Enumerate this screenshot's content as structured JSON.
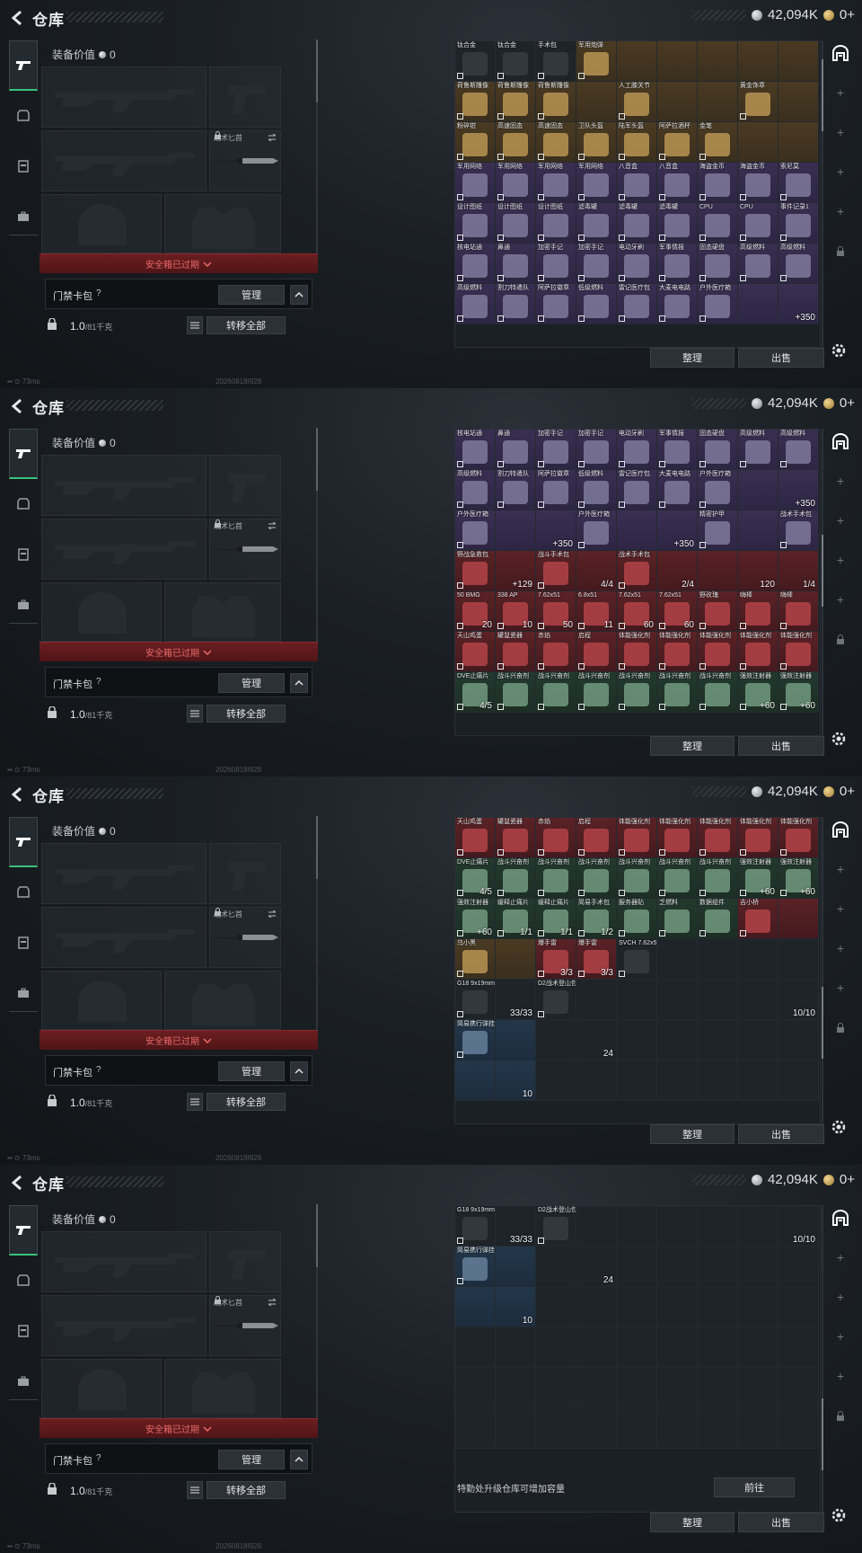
{
  "header": {
    "title": "仓库",
    "currency_value": "42,094K",
    "premium_value": "0+"
  },
  "equipment": {
    "value_label": "装备价值",
    "value_amount": "0",
    "knife_label": "战术匕首",
    "expired_text": "安全箱已过期",
    "keycard_label": "门禁卡包",
    "help": "?",
    "manage_label": "管理",
    "collapse_glyph": "^",
    "weight_value": "1.0",
    "weight_capacity": "/81千克",
    "transfer_all_label": "转移全部"
  },
  "left_tabs": [
    {
      "icon": "gun-icon"
    },
    {
      "icon": "armor-icon"
    },
    {
      "icon": "vest-icon"
    },
    {
      "icon": "backpack-icon"
    }
  ],
  "status_bar": {
    "ping": "73ms",
    "build": "20260818I928"
  },
  "stash": {
    "sort_label": "整理",
    "sell_label": "出售",
    "upgrade_text": "特勤处升级仓库可增加容量",
    "goto_label": "前往"
  },
  "right_rail": [
    "base-icon",
    "plus-icon",
    "plus-icon",
    "plus-icon",
    "plus-icon",
    "plus-icon",
    "lock-icon"
  ],
  "frames": [
    {
      "scroll_thumb_top": 0.08,
      "cells": [
        {
          "n": "钛合金",
          "r": "grey"
        },
        {
          "n": "钛合金",
          "r": "grey"
        },
        {
          "n": "手术包",
          "r": "grey"
        },
        {
          "n": "军用炮弹",
          "r": "gold"
        },
        {
          "n": "",
          "r": "gold"
        },
        {
          "n": "",
          "r": "gold"
        },
        {
          "n": "",
          "r": "gold"
        },
        {
          "n": "",
          "r": "gold"
        },
        {
          "n": "",
          "r": "gold"
        },
        {
          "n": "荷鲁斯雕像",
          "r": "gold"
        },
        {
          "n": "荷鲁斯雕像",
          "r": "gold"
        },
        {
          "n": "荷鲁斯雕像",
          "r": "gold"
        },
        {
          "n": "",
          "r": "gold"
        },
        {
          "n": "人工膝关节",
          "r": "gold"
        },
        {
          "n": "",
          "r": "gold"
        },
        {
          "n": "",
          "r": "gold"
        },
        {
          "n": "黄金饰章",
          "r": "gold"
        },
        {
          "n": "",
          "r": "gold"
        },
        {
          "n": "粉碎钳",
          "r": "gold"
        },
        {
          "n": "高速固态",
          "r": "gold"
        },
        {
          "n": "高速固态",
          "r": "gold"
        },
        {
          "n": "卫队头盔",
          "r": "gold"
        },
        {
          "n": "陆军头盔",
          "r": "gold"
        },
        {
          "n": "阿萨拉酒杯",
          "r": "gold"
        },
        {
          "n": "金笔",
          "r": "gold"
        },
        {
          "n": "",
          "r": "gold"
        },
        {
          "n": "",
          "r": "gold"
        },
        {
          "n": "军用网络",
          "r": "purple"
        },
        {
          "n": "军用网络",
          "r": "purple"
        },
        {
          "n": "军用网络",
          "r": "purple"
        },
        {
          "n": "军用网络",
          "r": "purple"
        },
        {
          "n": "八音盒",
          "r": "purple"
        },
        {
          "n": "八音盒",
          "r": "purple"
        },
        {
          "n": "海盗金币",
          "r": "purple"
        },
        {
          "n": "海盗金币",
          "r": "purple"
        },
        {
          "n": "索尼莫",
          "r": "purple"
        },
        {
          "n": "设计图纸",
          "r": "purple"
        },
        {
          "n": "设计图纸",
          "r": "purple"
        },
        {
          "n": "设计图纸",
          "r": "purple"
        },
        {
          "n": "滤毒罐",
          "r": "purple"
        },
        {
          "n": "滤毒罐",
          "r": "purple"
        },
        {
          "n": "滤毒罐",
          "r": "purple"
        },
        {
          "n": "CPU",
          "r": "purple"
        },
        {
          "n": "CPU",
          "r": "purple"
        },
        {
          "n": "事件记录1",
          "r": "purple"
        },
        {
          "n": "核电站通",
          "r": "purple"
        },
        {
          "n": "鼻通",
          "r": "purple"
        },
        {
          "n": "加密手记",
          "r": "purple"
        },
        {
          "n": "加密手记",
          "r": "purple"
        },
        {
          "n": "电动牙刷",
          "r": "purple"
        },
        {
          "n": "军事情报",
          "r": "purple"
        },
        {
          "n": "固态硬盘",
          "r": "purple"
        },
        {
          "n": "高级燃料",
          "r": "purple"
        },
        {
          "n": "高级燃料",
          "r": "purple"
        },
        {
          "n": "高级燃料",
          "r": "purple"
        },
        {
          "n": "割刀特遣队",
          "r": "purple"
        },
        {
          "n": "阿萨拉徽章",
          "r": "purple"
        },
        {
          "n": "低级燃料",
          "r": "purple"
        },
        {
          "n": "雷记医疗包",
          "r": "purple"
        },
        {
          "n": "大麦电电路",
          "r": "purple"
        },
        {
          "n": "户外医疗箱",
          "r": "purple"
        },
        {
          "n": "",
          "r": "purple"
        },
        {
          "n": "",
          "r": "purple",
          "c": "+350"
        }
      ]
    },
    {
      "scroll_thumb_top": 0.45,
      "cells": [
        {
          "n": "核电站通",
          "r": "purple"
        },
        {
          "n": "鼻通",
          "r": "purple"
        },
        {
          "n": "加密手记",
          "r": "purple"
        },
        {
          "n": "加密手记",
          "r": "purple"
        },
        {
          "n": "电动牙刷",
          "r": "purple"
        },
        {
          "n": "军事情报",
          "r": "purple"
        },
        {
          "n": "固态硬盘",
          "r": "purple"
        },
        {
          "n": "高级燃料",
          "r": "purple"
        },
        {
          "n": "高级燃料",
          "r": "purple"
        },
        {
          "n": "高级燃料",
          "r": "purple"
        },
        {
          "n": "割刀特遣队",
          "r": "purple"
        },
        {
          "n": "阿萨拉徽章",
          "r": "purple"
        },
        {
          "n": "低级燃料",
          "r": "purple"
        },
        {
          "n": "雷记医疗包",
          "r": "purple"
        },
        {
          "n": "大麦电电路",
          "r": "purple"
        },
        {
          "n": "户外医疗箱",
          "r": "purple"
        },
        {
          "n": "",
          "r": "purple"
        },
        {
          "n": "",
          "r": "purple",
          "c": "+350"
        },
        {
          "n": "户外医疗箱",
          "r": "purple"
        },
        {
          "n": "",
          "r": "purple"
        },
        {
          "n": "",
          "r": "purple",
          "c": "+350"
        },
        {
          "n": "户外医疗箱",
          "r": "purple"
        },
        {
          "n": "",
          "r": "purple"
        },
        {
          "n": "",
          "r": "purple",
          "c": "+350"
        },
        {
          "n": "精密护甲",
          "r": "purple"
        },
        {
          "n": "",
          "r": "purple"
        },
        {
          "n": "战术手术包",
          "r": "purple"
        },
        {
          "n": "野战急救包",
          "r": "red"
        },
        {
          "n": "",
          "r": "red",
          "c": "+129"
        },
        {
          "n": "战斗手术包",
          "r": "red"
        },
        {
          "n": "",
          "r": "red",
          "c": "4/4"
        },
        {
          "n": "战术手术包",
          "r": "red"
        },
        {
          "n": "",
          "r": "red",
          "c": "2/4"
        },
        {
          "n": "",
          "r": "red"
        },
        {
          "n": "",
          "r": "red",
          "c": "120"
        },
        {
          "n": "",
          "r": "red",
          "c": "1/4"
        },
        {
          "n": "50 BMG",
          "r": "red",
          "c": "20"
        },
        {
          "n": "338 AP",
          "r": "red",
          "c": "10"
        },
        {
          "n": "7.62x51",
          "r": "red",
          "c": "50"
        },
        {
          "n": "6.8x51",
          "r": "red",
          "c": "11"
        },
        {
          "n": "7.62x51",
          "r": "red",
          "c": "60"
        },
        {
          "n": "7.62x51",
          "r": "red",
          "c": "60"
        },
        {
          "n": "野玫瑰",
          "r": "red"
        },
        {
          "n": "嗨棒",
          "r": "red"
        },
        {
          "n": "嗨棒",
          "r": "red"
        },
        {
          "n": "天山鸡蛋",
          "r": "red"
        },
        {
          "n": "罐鼠瓷器",
          "r": "red"
        },
        {
          "n": "赤焰",
          "r": "red"
        },
        {
          "n": "启程",
          "r": "red"
        },
        {
          "n": "体能强化剂",
          "r": "red"
        },
        {
          "n": "体能强化剂",
          "r": "red"
        },
        {
          "n": "体能强化剂",
          "r": "red"
        },
        {
          "n": "体能强化剂",
          "r": "red"
        },
        {
          "n": "体能强化剂",
          "r": "red"
        },
        {
          "n": "DVE止痛片",
          "r": "green",
          "c": "4/5"
        },
        {
          "n": "战斗兴奋剂",
          "r": "green"
        },
        {
          "n": "战斗兴奋剂",
          "r": "green"
        },
        {
          "n": "战斗兴奋剂",
          "r": "green"
        },
        {
          "n": "战斗兴奋剂",
          "r": "green"
        },
        {
          "n": "战斗兴奋剂",
          "r": "green"
        },
        {
          "n": "战斗兴奋剂",
          "r": "green"
        },
        {
          "n": "强效注射器",
          "r": "green",
          "c": "+60"
        },
        {
          "n": "强效注射器",
          "r": "green",
          "c": "+60"
        }
      ]
    },
    {
      "scroll_thumb_top": 0.72,
      "cells": [
        {
          "n": "天山鸡蛋",
          "r": "red"
        },
        {
          "n": "罐鼠瓷器",
          "r": "red"
        },
        {
          "n": "赤焰",
          "r": "red"
        },
        {
          "n": "启程",
          "r": "red"
        },
        {
          "n": "体能强化剂",
          "r": "red"
        },
        {
          "n": "体能强化剂",
          "r": "red"
        },
        {
          "n": "体能强化剂",
          "r": "red"
        },
        {
          "n": "体能强化剂",
          "r": "red"
        },
        {
          "n": "体能强化剂",
          "r": "red"
        },
        {
          "n": "DVE止痛片",
          "r": "green",
          "c": "4/5"
        },
        {
          "n": "战斗兴奋剂",
          "r": "green"
        },
        {
          "n": "战斗兴奋剂",
          "r": "green"
        },
        {
          "n": "战斗兴奋剂",
          "r": "green"
        },
        {
          "n": "战斗兴奋剂",
          "r": "green"
        },
        {
          "n": "战斗兴奋剂",
          "r": "green"
        },
        {
          "n": "战斗兴奋剂",
          "r": "green"
        },
        {
          "n": "强效注射器",
          "r": "green",
          "c": "+60"
        },
        {
          "n": "强效注射器",
          "r": "green",
          "c": "+60"
        },
        {
          "n": "强效注射器",
          "r": "green",
          "c": "+60"
        },
        {
          "n": "缓释止痛片",
          "r": "green",
          "c": "1/1"
        },
        {
          "n": "缓释止痛片",
          "r": "green",
          "c": "1/1"
        },
        {
          "n": "简易手术包",
          "r": "green",
          "c": "1/2"
        },
        {
          "n": "服务器贴",
          "r": "green"
        },
        {
          "n": "乏燃料",
          "r": "green"
        },
        {
          "n": "数据组件",
          "r": "green"
        },
        {
          "n": "吉小桥",
          "r": "red"
        },
        {
          "n": "",
          "r": "red"
        },
        {
          "n": "乌小黑",
          "r": "gold"
        },
        {
          "n": "",
          "r": "gold"
        },
        {
          "n": "爆手雷",
          "r": "red",
          "c": "3/3"
        },
        {
          "n": "爆手雷",
          "r": "red",
          "c": "3/3"
        },
        {
          "n": "SVCH 7.62x54R",
          "r": "grey"
        },
        {
          "n": "",
          "r": "grey"
        },
        {
          "n": "",
          "r": "grey"
        },
        {
          "n": "",
          "r": "grey"
        },
        {
          "n": "",
          "r": "grey"
        },
        {
          "n": "G18 9x19mm",
          "r": "grey"
        },
        {
          "n": "",
          "r": "grey",
          "c": "33/33"
        },
        {
          "n": "D2战术登山包",
          "r": "grey"
        },
        {
          "n": "",
          "r": "grey"
        },
        {
          "n": "",
          "r": "grey"
        },
        {
          "n": "",
          "r": "grey"
        },
        {
          "n": "",
          "r": "grey"
        },
        {
          "n": "",
          "r": "grey"
        },
        {
          "n": "",
          "r": "grey",
          "c": "10/10"
        },
        {
          "n": "简易携行弹挂",
          "r": "blue"
        },
        {
          "n": "",
          "r": "blue"
        },
        {
          "n": "",
          "r": "grey"
        },
        {
          "n": "",
          "r": "grey",
          "c": "24"
        },
        {
          "n": "",
          "r": "grey"
        },
        {
          "n": "",
          "r": "grey"
        },
        {
          "n": "",
          "r": "grey"
        },
        {
          "n": "",
          "r": "grey"
        },
        {
          "n": "",
          "r": "grey"
        },
        {
          "n": "",
          "r": "blue"
        },
        {
          "n": "",
          "r": "blue",
          "c": "10"
        },
        {
          "n": "",
          "r": "grey"
        },
        {
          "n": "",
          "r": "grey"
        },
        {
          "n": "",
          "r": "grey"
        },
        {
          "n": "",
          "r": "grey"
        },
        {
          "n": "",
          "r": "grey"
        },
        {
          "n": "",
          "r": "grey"
        },
        {
          "n": "",
          "r": "grey"
        }
      ]
    },
    {
      "scroll_thumb_top": 0.82,
      "show_upgrade": true,
      "cells": [
        {
          "n": "G18 9x19mm",
          "r": "grey"
        },
        {
          "n": "",
          "r": "grey",
          "c": "33/33"
        },
        {
          "n": "D2战术登山包",
          "r": "grey"
        },
        {
          "n": "",
          "r": "grey"
        },
        {
          "n": "",
          "r": "grey"
        },
        {
          "n": "",
          "r": "grey"
        },
        {
          "n": "",
          "r": "grey"
        },
        {
          "n": "",
          "r": "grey"
        },
        {
          "n": "",
          "r": "grey",
          "c": "10/10"
        },
        {
          "n": "简易携行弹挂",
          "r": "blue"
        },
        {
          "n": "",
          "r": "blue"
        },
        {
          "n": "",
          "r": "grey"
        },
        {
          "n": "",
          "r": "grey",
          "c": "24"
        },
        {
          "n": "",
          "r": "grey"
        },
        {
          "n": "",
          "r": "grey"
        },
        {
          "n": "",
          "r": "grey"
        },
        {
          "n": "",
          "r": "grey"
        },
        {
          "n": "",
          "r": "grey"
        },
        {
          "n": "",
          "r": "blue"
        },
        {
          "n": "",
          "r": "blue",
          "c": "10"
        },
        {
          "n": "",
          "r": "grey"
        },
        {
          "n": "",
          "r": "grey"
        },
        {
          "n": "",
          "r": "grey"
        },
        {
          "n": "",
          "r": "grey"
        },
        {
          "n": "",
          "r": "grey"
        },
        {
          "n": "",
          "r": "grey"
        },
        {
          "n": "",
          "r": "grey"
        },
        {
          "n": "",
          "r": "grey"
        },
        {
          "n": "",
          "r": "grey"
        },
        {
          "n": "",
          "r": "grey"
        },
        {
          "n": "",
          "r": "grey"
        },
        {
          "n": "",
          "r": "grey"
        },
        {
          "n": "",
          "r": "grey"
        },
        {
          "n": "",
          "r": "grey"
        },
        {
          "n": "",
          "r": "grey"
        },
        {
          "n": "",
          "r": "grey"
        },
        {
          "n": "",
          "r": "grey"
        },
        {
          "n": "",
          "r": "grey"
        },
        {
          "n": "",
          "r": "grey"
        },
        {
          "n": "",
          "r": "grey"
        },
        {
          "n": "",
          "r": "grey"
        },
        {
          "n": "",
          "r": "grey"
        },
        {
          "n": "",
          "r": "grey"
        },
        {
          "n": "",
          "r": "grey"
        },
        {
          "n": "",
          "r": "grey"
        },
        {
          "n": "",
          "r": "grey"
        },
        {
          "n": "",
          "r": "grey"
        },
        {
          "n": "",
          "r": "grey"
        },
        {
          "n": "",
          "r": "grey"
        },
        {
          "n": "",
          "r": "grey"
        },
        {
          "n": "",
          "r": "grey"
        },
        {
          "n": "",
          "r": "grey"
        },
        {
          "n": "",
          "r": "grey"
        },
        {
          "n": "",
          "r": "grey"
        }
      ]
    }
  ]
}
